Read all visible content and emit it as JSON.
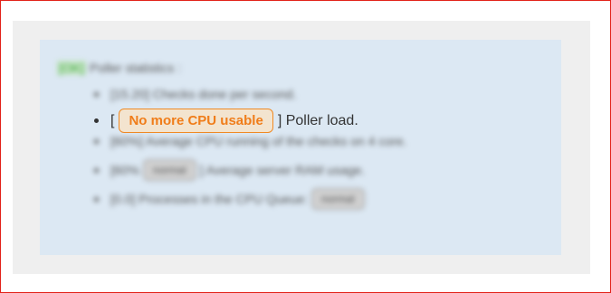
{
  "header": {
    "status_tag": "[OK]",
    "title": "Poller statistics :"
  },
  "stats": [
    {
      "prefix": "[",
      "value": "15.20",
      "suffix": "] Checks done per second."
    },
    {
      "prefix": "[",
      "badge": "No more CPU usable",
      "suffix": "] Poller load."
    },
    {
      "prefix": "[",
      "value": "60%",
      "suffix": "] Average CPU running of the checks on 4 core."
    },
    {
      "prefix": "[",
      "value": "60%",
      "badge": "normal",
      "suffix": "] Average server RAM usage."
    },
    {
      "prefix": "[",
      "value": "0.0",
      "suffix": "] Processes in the CPU Queue:",
      "badge": "normal"
    }
  ],
  "colors": {
    "frame_border": "#e2231a",
    "info_background": "#dce8f3",
    "warning": "#f07d1a",
    "ok": "#3aa63a"
  }
}
